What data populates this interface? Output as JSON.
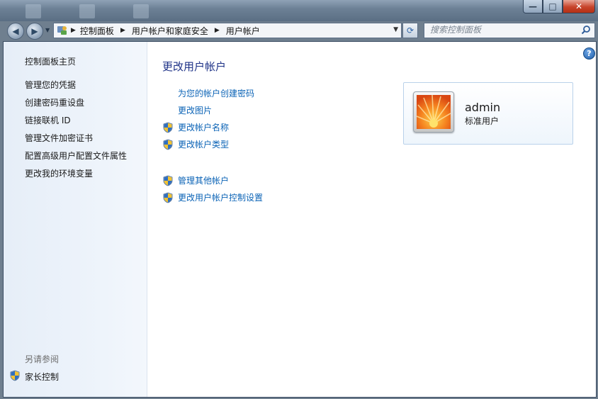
{
  "window": {
    "minimize_glyph": "—",
    "maximize_glyph": "□",
    "close_glyph": "✕"
  },
  "navigation": {
    "back_glyph": "◀",
    "forward_glyph": "▶",
    "dropdown_glyph": "▼"
  },
  "address": {
    "breadcrumbs": [
      "控制面板",
      "用户帐户和家庭安全",
      "用户帐户"
    ],
    "separator": "▶",
    "dropdown_glyph": "▼",
    "refresh_glyph": "⟳"
  },
  "search": {
    "placeholder": "搜索控制面板"
  },
  "left_pane": {
    "home_link": "控制面板主页",
    "tasks": [
      "管理您的凭据",
      "创建密码重设盘",
      "链接联机 ID",
      "管理文件加密证书",
      "配置高级用户配置文件属性",
      "更改我的环境变量"
    ],
    "see_also_label": "另请参阅",
    "see_also_links": [
      "家长控制"
    ]
  },
  "main": {
    "heading": "更改用户帐户",
    "links_group1": [
      {
        "label": "为您的帐户创建密码",
        "shield": false
      },
      {
        "label": "更改图片",
        "shield": false
      },
      {
        "label": "更改帐户名称",
        "shield": true
      },
      {
        "label": "更改帐户类型",
        "shield": true
      }
    ],
    "links_group2": [
      {
        "label": "管理其他帐户",
        "shield": true
      },
      {
        "label": "更改用户帐户控制设置",
        "shield": true
      }
    ]
  },
  "account": {
    "name": "admin",
    "type": "标准用户"
  },
  "help_glyph": "?",
  "icons": {
    "shield": "uac-shield-icon",
    "search": "magnifier-icon",
    "address": "control-panel-icon",
    "picture": "orange-flower-icon"
  },
  "colors": {
    "link": "#0b63b6",
    "heading": "#1e3287"
  }
}
